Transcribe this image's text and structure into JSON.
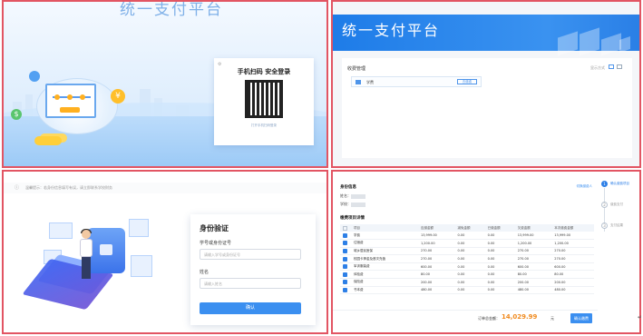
{
  "panel_login": {
    "title": "统一支付平台",
    "qr_title": "手机扫码 安全登录",
    "qr_hint": "打开手机扫码登录",
    "badge_y": "¥",
    "badge_g": "$"
  },
  "panel_home": {
    "banner_title": "统一支付平台",
    "section_title": "收费管理",
    "view_switch": "显示方式",
    "item_name": "学费",
    "item_button": "去缴费"
  },
  "panel_verify": {
    "notice_icon": "ⓘ",
    "notice_text": "温馨提示：若身份信息填写有误，请立即联系学校财务",
    "card_title": "身份验证",
    "field1_label": "学号或身份证号",
    "field1_placeholder": "请输入学号或身份证号",
    "field2_label": "姓名",
    "field2_placeholder": "请输入姓名",
    "confirm": "确认"
  },
  "panel_pay": {
    "header": "身份信息",
    "switch_link": "切换缴费人",
    "name_label": "姓名：",
    "school_label": "学校：",
    "section": "缴费项目详情",
    "columns": [
      "项目",
      "应缴金额",
      "减免金额",
      "已缴金额",
      "欠费金额",
      "本次缴费金额"
    ],
    "rows": [
      [
        "学费",
        "13,999.00",
        "0.00",
        "0.00",
        "13,999.00",
        "13,999.00"
      ],
      [
        "住宿费",
        "1,200.00",
        "0.00",
        "0.00",
        "1,200.00",
        "1,200.00"
      ],
      [
        "城乡居民医保",
        "270.00",
        "0.00",
        "0.00",
        "270.00",
        "270.00"
      ],
      [
        "校园卡押金及首次充值",
        "270.00",
        "0.00",
        "0.00",
        "270.00",
        "270.00"
      ],
      [
        "军训服装费",
        "600.00",
        "0.00",
        "0.00",
        "600.00",
        "600.00"
      ],
      [
        "体检费",
        "80.00",
        "0.00",
        "0.00",
        "80.00",
        "80.00"
      ],
      [
        "保险费",
        "200.00",
        "0.00",
        "0.00",
        "200.00",
        "200.00"
      ],
      [
        "书本费",
        "480.00",
        "0.00",
        "0.00",
        "480.00",
        "480.00"
      ]
    ],
    "total_label": "订单总金额：",
    "total_amount": "14,029.99",
    "total_unit": "元",
    "pay_button": "确认缴费",
    "steps": [
      {
        "num": "1",
        "label": "确认缴费项目",
        "active": true
      },
      {
        "num": "2",
        "label": "缴费支付",
        "active": false
      },
      {
        "num": "3",
        "label": "支付结果",
        "active": false
      }
    ]
  },
  "corner_mark": "↵"
}
